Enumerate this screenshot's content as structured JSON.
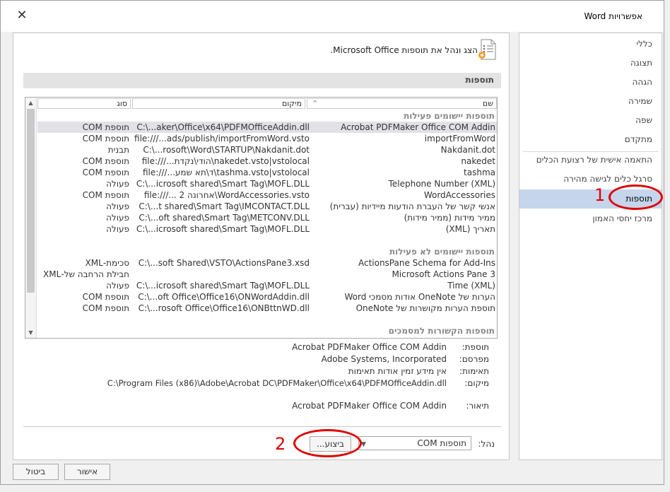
{
  "window": {
    "title": "אפשרויות Word",
    "close_glyph": "✕"
  },
  "nav": {
    "items": [
      {
        "label": "כללי"
      },
      {
        "label": "תצוגה"
      },
      {
        "label": "הגהה"
      },
      {
        "label": "שמירה"
      },
      {
        "label": "שפה"
      },
      {
        "label": "מתקדם"
      },
      {
        "label": "התאמה אישית של רצועת הכלים"
      },
      {
        "label": "סרגל כלים לגישה מהירה"
      },
      {
        "label": "תוספות"
      },
      {
        "label": "מרכז יחסי האמון"
      }
    ],
    "selected_index": 8
  },
  "main": {
    "header_text": "הצג ונהל את תוספות Microsoft Office.",
    "section_title": "תוספות",
    "icon": "addins-gear-icon"
  },
  "list": {
    "columns": {
      "name": "שם",
      "sort_glyph": "⌃",
      "location": "מיקום",
      "type": "סוג"
    },
    "groups": [
      {
        "title": "תוספות יישומים פעילות",
        "rows": [
          {
            "name": "Acrobat PDFMaker Office COM Addin",
            "location": "C:\\...aker\\Office\\x64\\PDFMOfficeAddin.dll",
            "type": "תוספת COM",
            "selected": true
          },
          {
            "name": "importFromWord",
            "location": "file:///...ads/publish/importFromWord.vsto",
            "type": "תוספת COM"
          },
          {
            "name": "Nakdanit.dot",
            "location": "C:\\...rosoft\\Word\\STARTUP\\Nakdanit.dot",
            "type": "תבנית"
          },
          {
            "name": "nakedet",
            "location": "file:///...הודי\\נקדת\\nakedet.vsto|vstolocal",
            "type": "תוספת COM"
          },
          {
            "name": "tashma",
            "location": "file:///...ד\\תא שמע\\tashma.vsto|vstolocal",
            "type": "תוספת COM"
          },
          {
            "name": "Telephone Number (XML)",
            "location": "C:\\...icrosoft shared\\Smart Tag\\MOFL.DLL",
            "type": "פעולה"
          },
          {
            "name": "WordAccessories",
            "location": "file:///... 2 אחרונה\\WordAccessories.vsto",
            "type": "תוספת COM"
          },
          {
            "name": "אנשי קשר של העברת הודעות מיידיות (עברית)",
            "location": "C:\\...t shared\\Smart Tag\\IMCONTACT.DLL",
            "type": "פעולה"
          },
          {
            "name": "ממיר מידות (ממיר מידות)",
            "location": "C:\\...oft shared\\Smart Tag\\METCONV.DLL",
            "type": "פעולה"
          },
          {
            "name": "תאריך (XML)",
            "location": "C:\\...icrosoft shared\\Smart Tag\\MOFL.DLL",
            "type": "פעולה"
          }
        ]
      },
      {
        "title": "תוספות יישומים לא פעילות",
        "rows": [
          {
            "name": "ActionsPane Schema for Add-Ins",
            "location": "C:\\...soft Shared\\VSTO\\ActionsPane3.xsd",
            "type": "סכימת-XML"
          },
          {
            "name": "Microsoft Actions Pane 3",
            "location": "",
            "type": "חבילת הרחבה של-XML"
          },
          {
            "name": "Time (XML)",
            "location": "C:\\...icrosoft shared\\Smart Tag\\MOFL.DLL",
            "type": "פעולה"
          },
          {
            "name": "הערות של OneNote אודות מסמכי Word",
            "location": "C:\\...oft Office\\Office16\\ONWordAddin.dll",
            "type": "תוספת COM"
          },
          {
            "name": "תוספת הערות מקושרות של OneNote",
            "location": "C:\\...rosoft Office\\Office16\\ONBttnWD.dll",
            "type": "תוספת COM"
          }
        ]
      },
      {
        "title": "תוספות הקשורות למסמכים",
        "rows": []
      }
    ]
  },
  "details": {
    "addin_label": "תוספת:",
    "addin_value": "Acrobat PDFMaker Office COM Addin",
    "publisher_label": "מפרסם:",
    "publisher_value": "Adobe Systems, Incorporated",
    "compat_label": "תאימות:",
    "compat_value": "אין מידע זמין אודות תאימות",
    "location_label": "מיקום:",
    "location_value": "C:\\Program Files (x86)\\Adobe\\Acrobat DC\\PDFMaker\\Office\\x64\\PDFMOfficeAddin.dll",
    "desc_label": "תיאור:",
    "desc_value": "Acrobat PDFMaker Office COM Addin"
  },
  "manage": {
    "label": "נהל:",
    "selected": "תוספות COM",
    "go_label": "ביצוע..."
  },
  "footer": {
    "ok_label": "אישור",
    "cancel_label": "ביטול"
  },
  "annotations": {
    "n1": "1",
    "n2": "2",
    "color": "#e00000"
  }
}
